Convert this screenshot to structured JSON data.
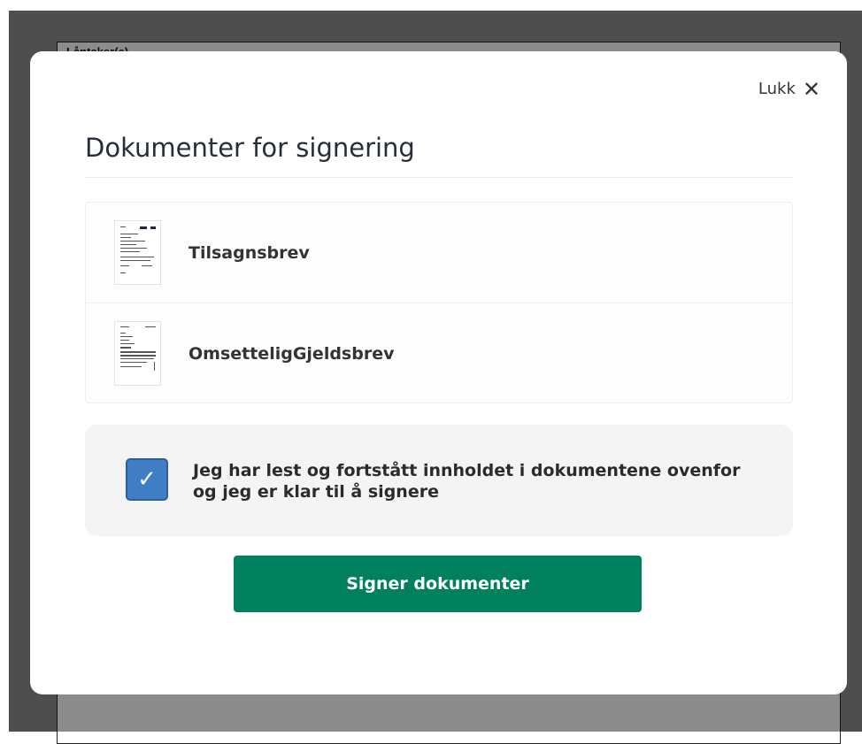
{
  "background": {
    "header_label": "Låntaker(e)"
  },
  "modal": {
    "close_label": "Lukk",
    "close_icon": "close-icon",
    "title": "Dokumenter for signering",
    "documents": [
      {
        "label": "Tilsagnsbrev",
        "icon": "document-thumbnail"
      },
      {
        "label": "OmsetteligGjeldsbrev",
        "icon": "document-thumbnail"
      }
    ],
    "consent": {
      "checked": true,
      "text": "Jeg har lest og fortstått innholdet i dokumentene ovenfor og jeg er klar til å signere"
    },
    "sign_button_label": "Signer dokumenter"
  },
  "colors": {
    "primary_button": "#00805c",
    "checkbox": "#3f7ec4",
    "overlay": "#8f8f8f"
  }
}
